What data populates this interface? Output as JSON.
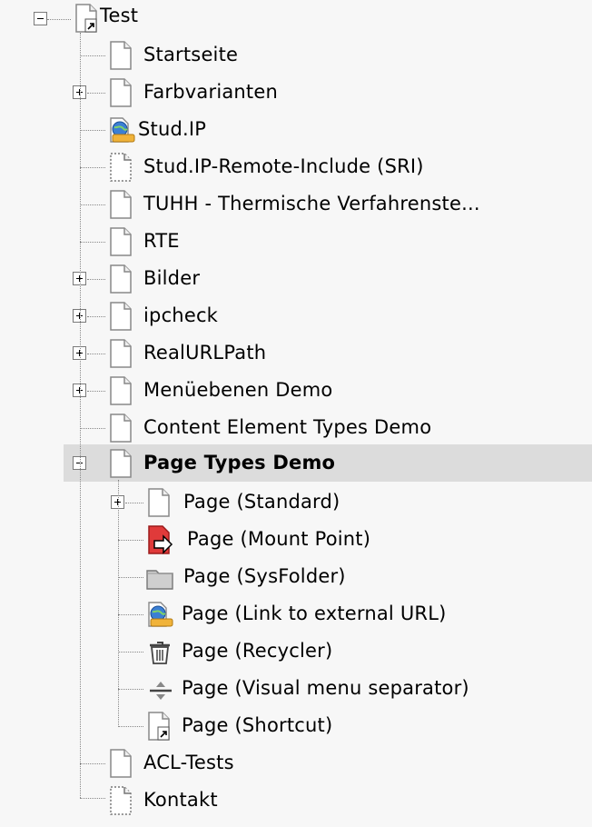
{
  "tree": {
    "root": {
      "label": "Test",
      "icon": "page-shortcut-icon",
      "expanded": true
    },
    "children": [
      {
        "label": "Startseite",
        "icon": "page-icon"
      },
      {
        "label": "Farbvarianten",
        "icon": "page-icon",
        "has_children": true
      },
      {
        "label": "Stud.IP",
        "icon": "page-external-url-icon"
      },
      {
        "label": "Stud.IP-Remote-Include (SRI)",
        "icon": "page-hidden-icon"
      },
      {
        "label": "TUHH - Thermische Verfahrenste...",
        "icon": "page-icon"
      },
      {
        "label": "RTE",
        "icon": "page-icon"
      },
      {
        "label": "Bilder",
        "icon": "page-icon",
        "has_children": true
      },
      {
        "label": "ipcheck",
        "icon": "page-icon",
        "has_children": true
      },
      {
        "label": "RealURLPath",
        "icon": "page-icon",
        "has_children": true
      },
      {
        "label": "Menüebenen Demo",
        "icon": "page-icon",
        "has_children": true
      },
      {
        "label": "Content Element Types Demo",
        "icon": "page-icon"
      },
      {
        "label": "Page Types Demo",
        "icon": "page-icon",
        "expanded": true,
        "selected": true,
        "children": [
          {
            "label": "Page (Standard)",
            "icon": "page-icon",
            "has_children": true
          },
          {
            "label": "Page (Mount Point)",
            "icon": "page-mount-point-icon"
          },
          {
            "label": "Page (SysFolder)",
            "icon": "folder-icon"
          },
          {
            "label": "Page (Link to external URL)",
            "icon": "page-external-url-icon"
          },
          {
            "label": "Page (Recycler)",
            "icon": "recycler-icon"
          },
          {
            "label": "Page (Visual menu separator)",
            "icon": "menu-separator-icon"
          },
          {
            "label": "Page (Shortcut)",
            "icon": "page-shortcut-icon"
          }
        ]
      },
      {
        "label": "ACL-Tests",
        "icon": "page-icon"
      },
      {
        "label": "Kontakt",
        "icon": "page-hidden-icon"
      }
    ]
  },
  "colors": {
    "background": "#f7f7f7",
    "selected_row": "#dcdcdc",
    "mount_point_red": "#e03a3a",
    "tree_line": "#888888"
  }
}
